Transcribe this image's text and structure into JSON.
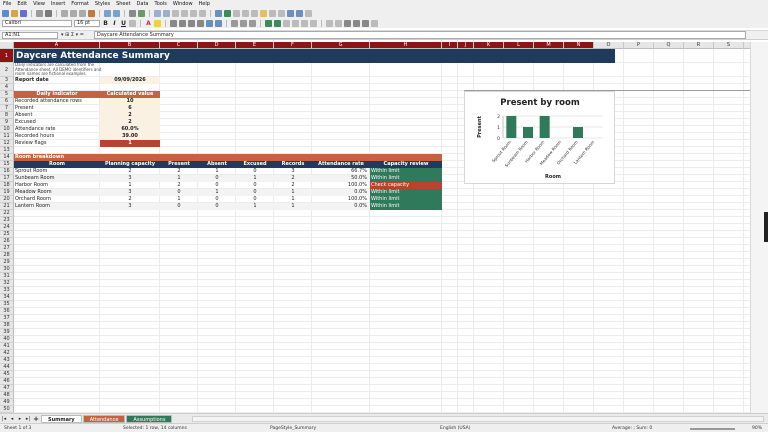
{
  "menu": [
    "File",
    "Edit",
    "View",
    "Insert",
    "Format",
    "Styles",
    "Sheet",
    "Data",
    "Tools",
    "Window",
    "Help"
  ],
  "font": {
    "name": "Calibri",
    "size": "16 pt"
  },
  "formula": {
    "cell_ref": "A1:N1",
    "content": "Daycare Attendance Summary"
  },
  "columns": [
    "A",
    "B",
    "C",
    "D",
    "E",
    "F",
    "G",
    "H",
    "I",
    "J",
    "K",
    "L",
    "M",
    "N",
    "O",
    "P",
    "Q",
    "R",
    "S",
    "T",
    "U"
  ],
  "rows": [
    "1",
    "2",
    "3",
    "4",
    "5",
    "6",
    "7",
    "8",
    "9",
    "10",
    "11",
    "12",
    "13",
    "14",
    "15",
    "16",
    "17",
    "18",
    "19",
    "20",
    "21",
    "22",
    "23",
    "24",
    "25",
    "26",
    "27",
    "28",
    "29",
    "30",
    "31",
    "32",
    "33",
    "34",
    "35",
    "36",
    "37",
    "38",
    "39",
    "40",
    "41",
    "42",
    "43",
    "44",
    "45",
    "46",
    "47",
    "48",
    "49",
    "50",
    "51"
  ],
  "sheet": {
    "title": "Daycare Attendance Summary",
    "note_line1": "Daily indicators are calculated from the",
    "note_line2": "Attendance sheet. All DEMO identifiers and",
    "note_line3": "room names are fictional examples.",
    "report_date_label": "Report date",
    "report_date": "09/09/2026",
    "indicator_header": "Daily indicator",
    "value_header": "Calculated value",
    "indicators": [
      {
        "label": "Recorded attendance rows",
        "value": "10"
      },
      {
        "label": "Present",
        "value": "6"
      },
      {
        "label": "Absent",
        "value": "2"
      },
      {
        "label": "Excused",
        "value": "2"
      },
      {
        "label": "Attendance rate",
        "value": "60.0%"
      },
      {
        "label": "Recorded hours",
        "value": "39.00"
      },
      {
        "label": "Review flags",
        "value": "1"
      }
    ],
    "room_section": "Room breakdown",
    "room_headers": [
      "Room",
      "Planning capacity",
      "Present",
      "Absent",
      "Excused",
      "Records",
      "Attendance rate",
      "Capacity review"
    ],
    "rooms": [
      {
        "room": "Sprout Room",
        "capacity": "2",
        "present": "2",
        "absent": "1",
        "excused": "0",
        "records": "3",
        "rate": "66.7%",
        "review": "Within limit",
        "status": "ok"
      },
      {
        "room": "Sunbeam Room",
        "capacity": "3",
        "present": "1",
        "absent": "0",
        "excused": "1",
        "records": "2",
        "rate": "50.0%",
        "review": "Within limit",
        "status": "ok"
      },
      {
        "room": "Harbor Room",
        "capacity": "1",
        "present": "2",
        "absent": "0",
        "excused": "0",
        "records": "2",
        "rate": "100.0%",
        "review": "Check capacity",
        "status": "warn"
      },
      {
        "room": "Meadow Room",
        "capacity": "3",
        "present": "0",
        "absent": "1",
        "excused": "0",
        "records": "1",
        "rate": "0.0%",
        "review": "Within limit",
        "status": "ok"
      },
      {
        "room": "Orchard Room",
        "capacity": "2",
        "present": "1",
        "absent": "0",
        "excused": "0",
        "records": "1",
        "rate": "100.0%",
        "review": "Within limit",
        "status": "ok"
      },
      {
        "room": "Lantern Room",
        "capacity": "3",
        "present": "0",
        "absent": "0",
        "excused": "1",
        "records": "1",
        "rate": "0.0%",
        "review": "Within limit",
        "status": "ok"
      }
    ]
  },
  "chart_data": {
    "type": "bar",
    "title": "Present by room",
    "xlabel": "Room",
    "ylabel": "Present",
    "categories": [
      "Sprout Room",
      "Sunbeam Room",
      "Harbor Room",
      "Meadow Room",
      "Orchard Room",
      "Lantern Room"
    ],
    "values": [
      2,
      1,
      2,
      0,
      1,
      0
    ],
    "ylim": [
      0,
      2
    ],
    "yticks": [
      "0",
      "1",
      "2"
    ],
    "grid": true,
    "bar_color": "#2f7a5a"
  },
  "tabs": [
    "Summary",
    "Attendance",
    "Assumptions"
  ],
  "status": {
    "sheet": "Sheet 1 of 3",
    "selection": "Selected: 1 row, 14 columns",
    "style": "PageStyle_Summary",
    "lang": "English (USA)",
    "calc": "Average: ; Sum: 0",
    "zoom": "90%"
  },
  "colors": {
    "navy": "#1f3b5b",
    "rust": "#c7623f",
    "green": "#2f7a5a",
    "red": "#b8432f"
  }
}
